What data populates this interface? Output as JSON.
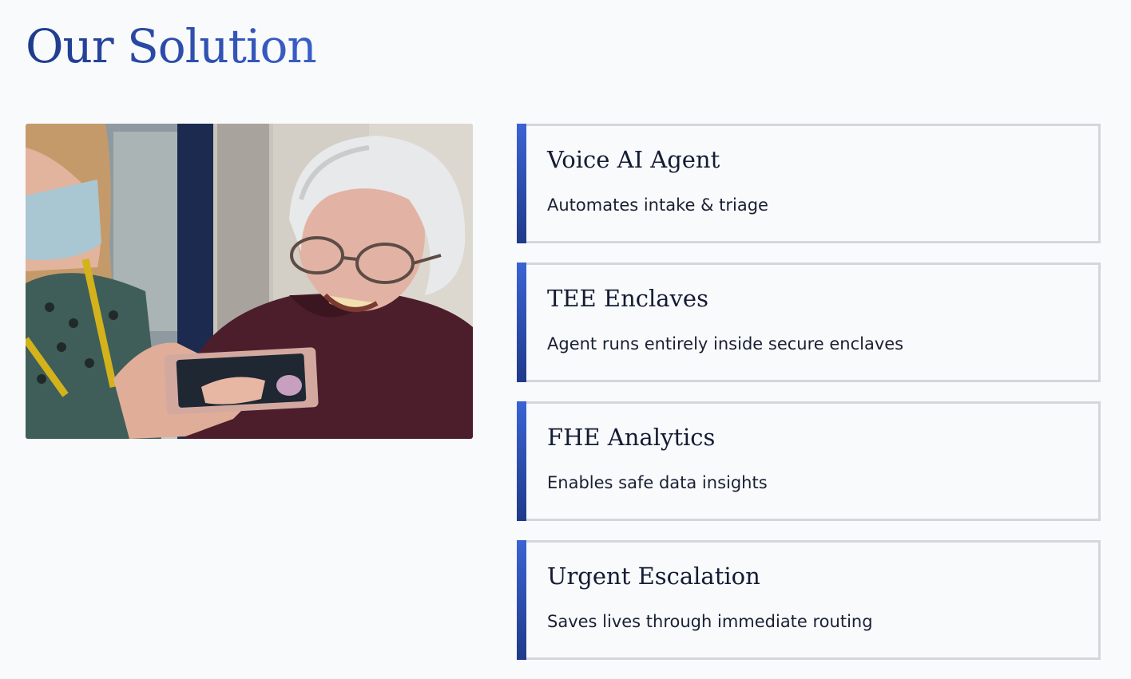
{
  "page": {
    "title": "Our Solution"
  },
  "colors": {
    "title_gradient_start": "#1e3a8a",
    "title_gradient_end": "#3b5fc8",
    "card_accent": "#2747b3",
    "card_border": "#d4d6da",
    "background": "#f8fafc"
  },
  "cards": [
    {
      "title": "Voice AI Agent",
      "description": "Automates intake & triage"
    },
    {
      "title": "TEE Enclaves",
      "description": "Agent runs entirely inside secure enclaves"
    },
    {
      "title": "FHE Analytics",
      "description": "Enables safe data insights"
    },
    {
      "title": "Urgent Escalation",
      "description": "Saves lives through immediate routing"
    }
  ]
}
